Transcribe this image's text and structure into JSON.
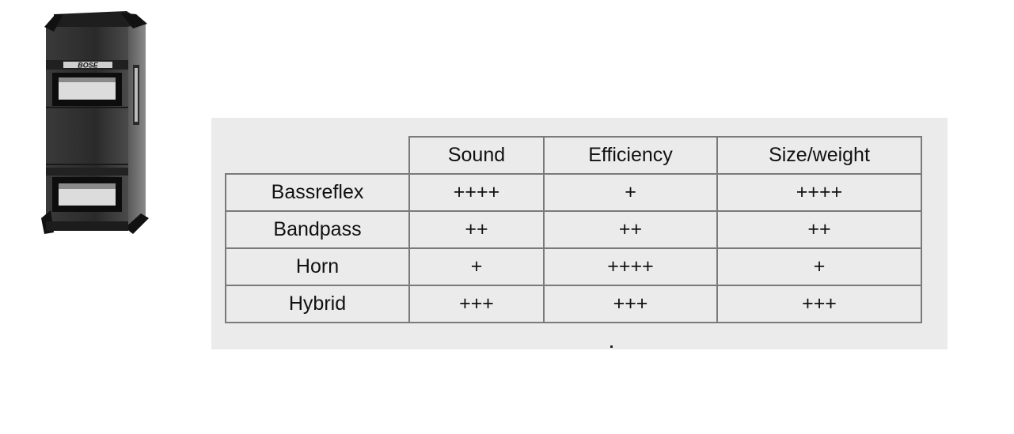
{
  "image": {
    "brand_logo_text": "BOSE"
  },
  "table": {
    "columns": [
      "Sound",
      "Efficiency",
      "Size/weight"
    ],
    "rows": [
      {
        "name": "Bassreflex",
        "cells": [
          "++++",
          "+",
          "++++"
        ]
      },
      {
        "name": "Bandpass",
        "cells": [
          "++",
          "++",
          "++"
        ]
      },
      {
        "name": "Horn",
        "cells": [
          "+",
          "++++",
          "+"
        ]
      },
      {
        "name": "Hybrid",
        "cells": [
          "+++",
          "+++",
          "+++"
        ]
      }
    ]
  },
  "colors": {
    "panel_background": "#ebebeb",
    "grid_line": "#7a7a7a",
    "text": "#111111"
  }
}
